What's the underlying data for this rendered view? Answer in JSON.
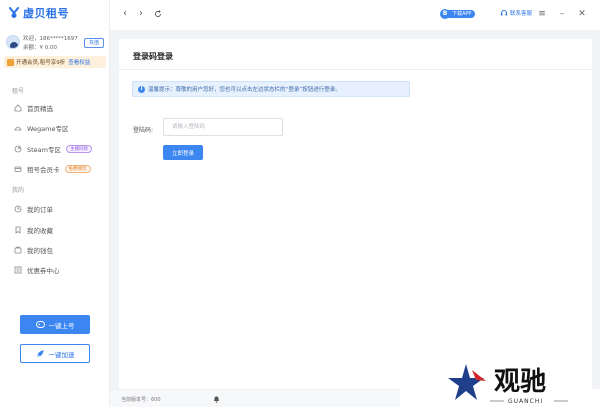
{
  "app": {
    "logo_text": "虚贝租号",
    "accent_color": "#3b86f1"
  },
  "user": {
    "greeting_line": "欢迎，186*****1697",
    "balance_line": "余额：¥ 0.00",
    "recharge_label": "充值"
  },
  "vip": {
    "text": "开通会员,租号享9折",
    "link": "查看权益"
  },
  "sidebar": {
    "section_rent": "租号",
    "section_mine": "我的",
    "rent_items": [
      {
        "label": "首页精选",
        "icon": "home-icon"
      },
      {
        "label": "Wegame专区",
        "icon": "wegame-icon"
      },
      {
        "label": "Steam专区",
        "icon": "steam-icon",
        "tag": "主播同款"
      },
      {
        "label": "租号会员卡",
        "icon": "card-icon",
        "tag": "免费畅玩"
      }
    ],
    "mine_items": [
      {
        "label": "我的订单",
        "icon": "order-icon"
      },
      {
        "label": "我的收藏",
        "icon": "favorite-icon"
      },
      {
        "label": "我的钱包",
        "icon": "wallet-icon"
      },
      {
        "label": "优惠券中心",
        "icon": "coupon-icon"
      }
    ],
    "btn_one_click": "一键上号",
    "btn_accelerate": "一键加速",
    "version_text": "当前版本号：600"
  },
  "topbar": {
    "download_badge": "B",
    "download_text": "下载APP",
    "service_text": "联系客服"
  },
  "main": {
    "title": "登录码登录",
    "notice": "温馨提示：尊敬的用户您好，您也可以点击左边状态栏的“登录”按钮进行登录。",
    "field_label": "登陆码:",
    "input_placeholder": "请输入登陆码",
    "login_button": "立即登录"
  },
  "watermark": {
    "text": "观驰",
    "subtext": "GUANCHI"
  }
}
